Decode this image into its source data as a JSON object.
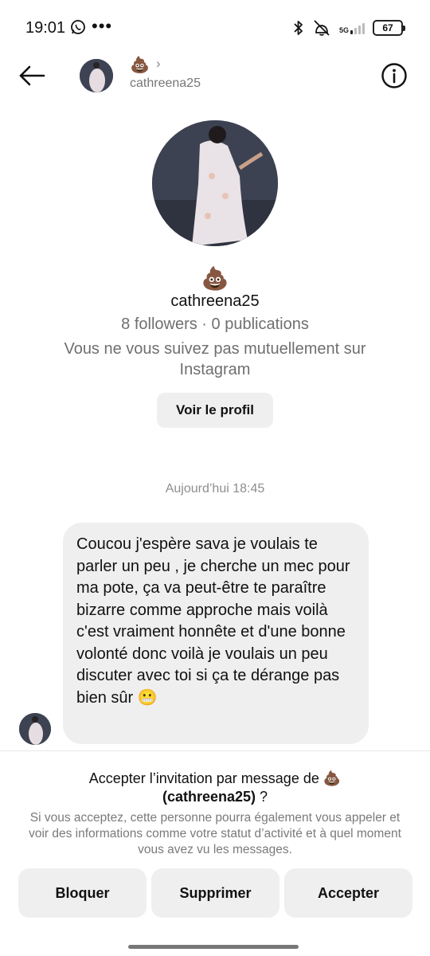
{
  "status_bar": {
    "time": "19:01",
    "more": "•••",
    "network": "5G",
    "battery": "67",
    "icons": [
      "whatsapp-icon",
      "bluetooth-icon",
      "vibrate-off-icon",
      "signal-icon",
      "battery-icon"
    ]
  },
  "header": {
    "emoji": "💩",
    "chevron": "›",
    "username": "cathreena25",
    "icons": [
      "back-arrow-icon",
      "info-icon"
    ]
  },
  "profile": {
    "emoji": "💩",
    "username": "cathreena25",
    "stats": "8 followers · 0 publications",
    "mutual_text": "Vous ne vous suivez pas mutuellement sur Instagram",
    "view_profile_label": "Voir le profil"
  },
  "conversation": {
    "timestamp": "Aujourd’hui 18:45",
    "messages": [
      {
        "text": "Coucou j'espère sava je voulais te parler un peu , je cherche un mec pour ma pote, ça va peut-être te paraître bizarre comme approche mais voilà c'est vraiment honnête et d'une bonne volonté donc voilà je voulais un peu discuter avec toi si ça te dérange pas bien sûr 😬"
      }
    ]
  },
  "request": {
    "title_prefix": "Accepter l’invitation par message de 💩",
    "title_name": "(cathreena25)",
    "title_suffix": " ?",
    "description": "Si vous acceptez, cette personne pourra également vous appeler et voir des informations comme votre statut d’activité et à quel moment vous avez vu les messages.",
    "buttons": {
      "block": "Bloquer",
      "delete": "Supprimer",
      "accept": "Accepter"
    }
  }
}
